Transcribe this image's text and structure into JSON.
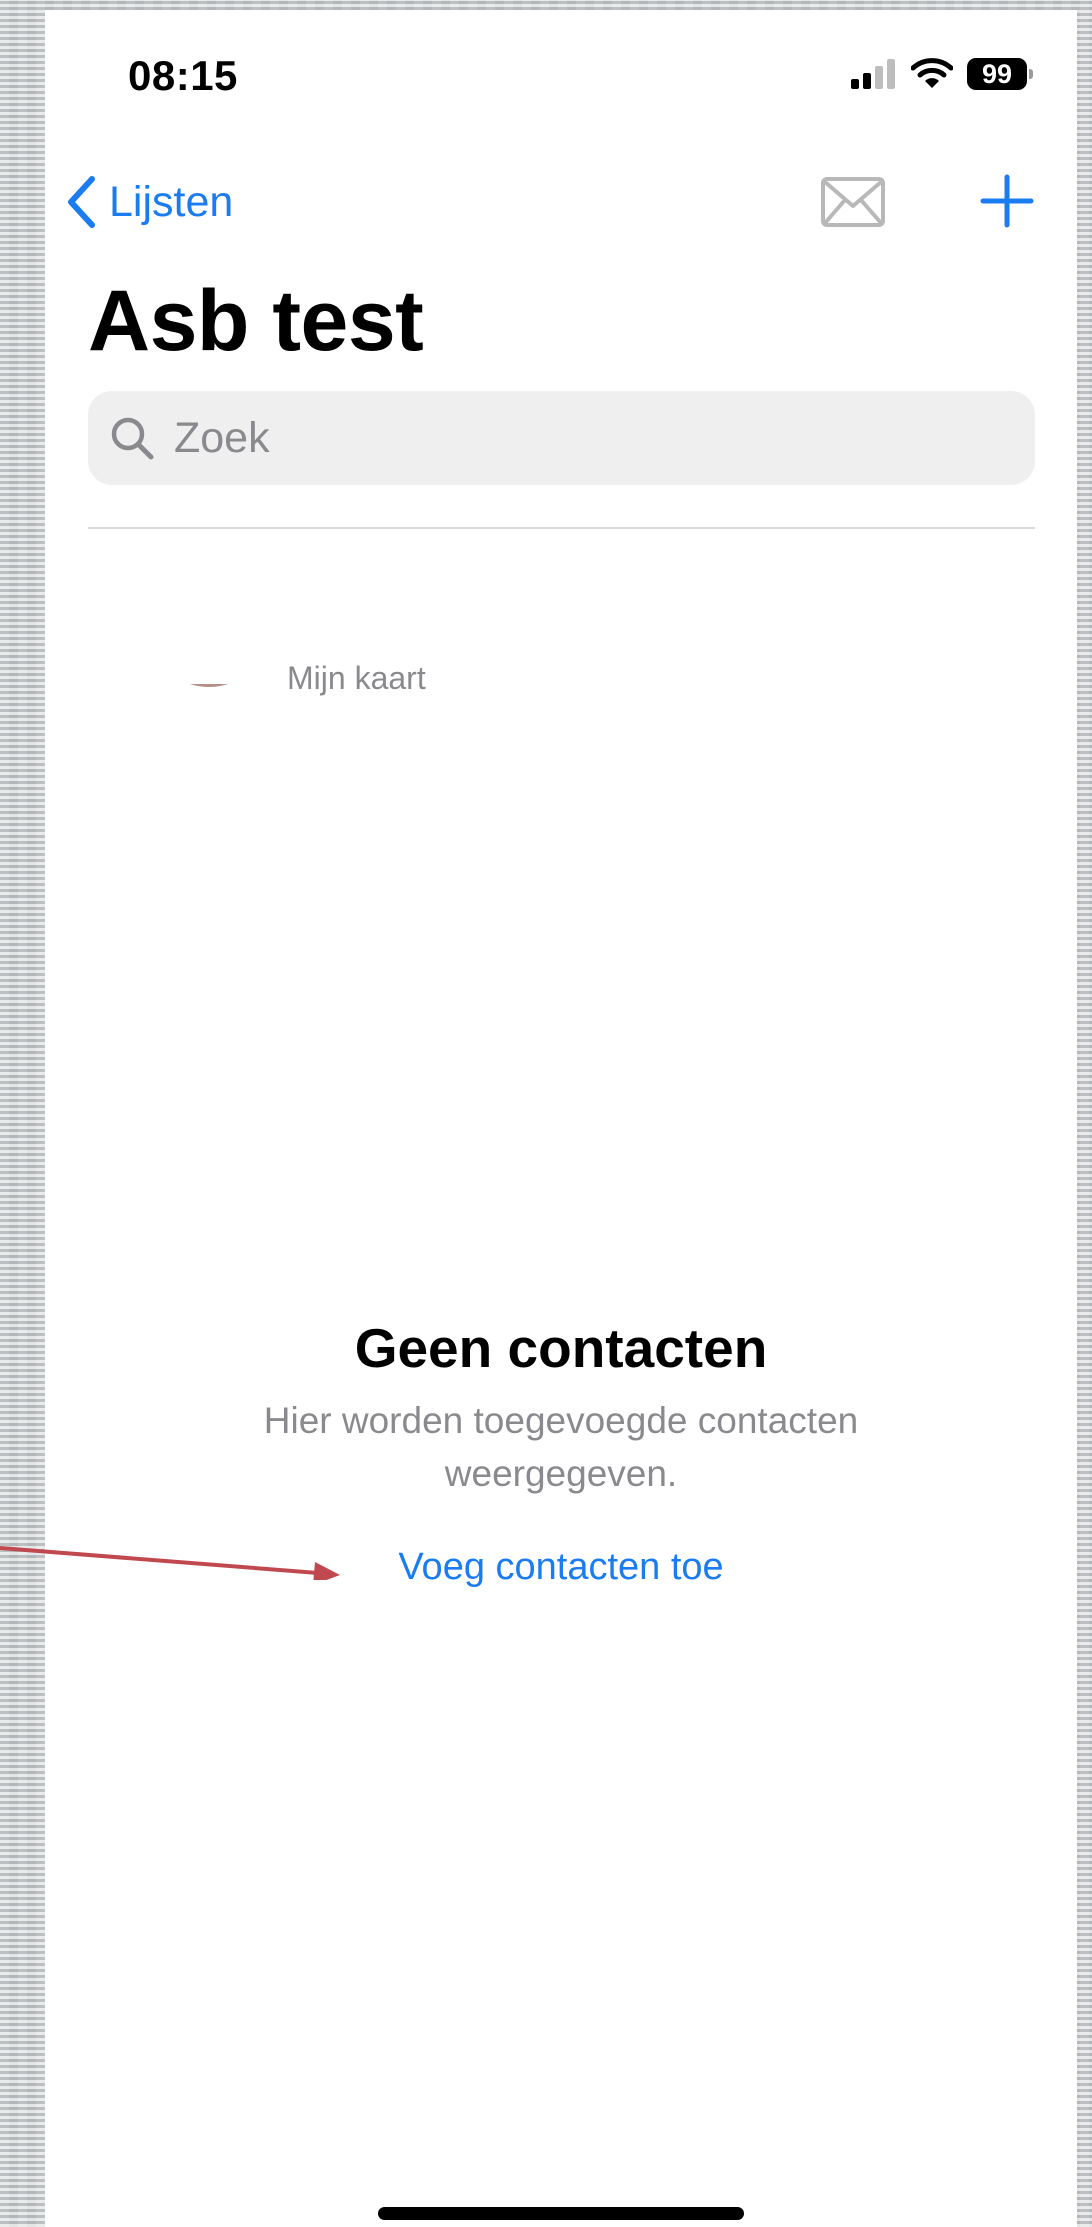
{
  "status_bar": {
    "time": "08:15",
    "battery": "99",
    "icons": [
      "signal-icon",
      "wifi-icon",
      "battery-icon"
    ]
  },
  "nav": {
    "back_label": "Lijsten",
    "icons": [
      "chevron-left-icon",
      "mail-icon",
      "plus-icon"
    ]
  },
  "header": {
    "title": "Asb test"
  },
  "search": {
    "placeholder": "Zoek",
    "value": "",
    "icon": "search-icon"
  },
  "my_card": {
    "label": "Mijn kaart"
  },
  "empty_state": {
    "title": "Geen contacten",
    "description": "Hier worden toegevoegde contacten weergegeven.",
    "action_label": "Voeg contacten toe"
  },
  "colors": {
    "accent": "#1a7cf0",
    "secondary_text": "#8a8a8e",
    "search_background": "#efefef",
    "annotation_arrow": "#c0494f"
  }
}
